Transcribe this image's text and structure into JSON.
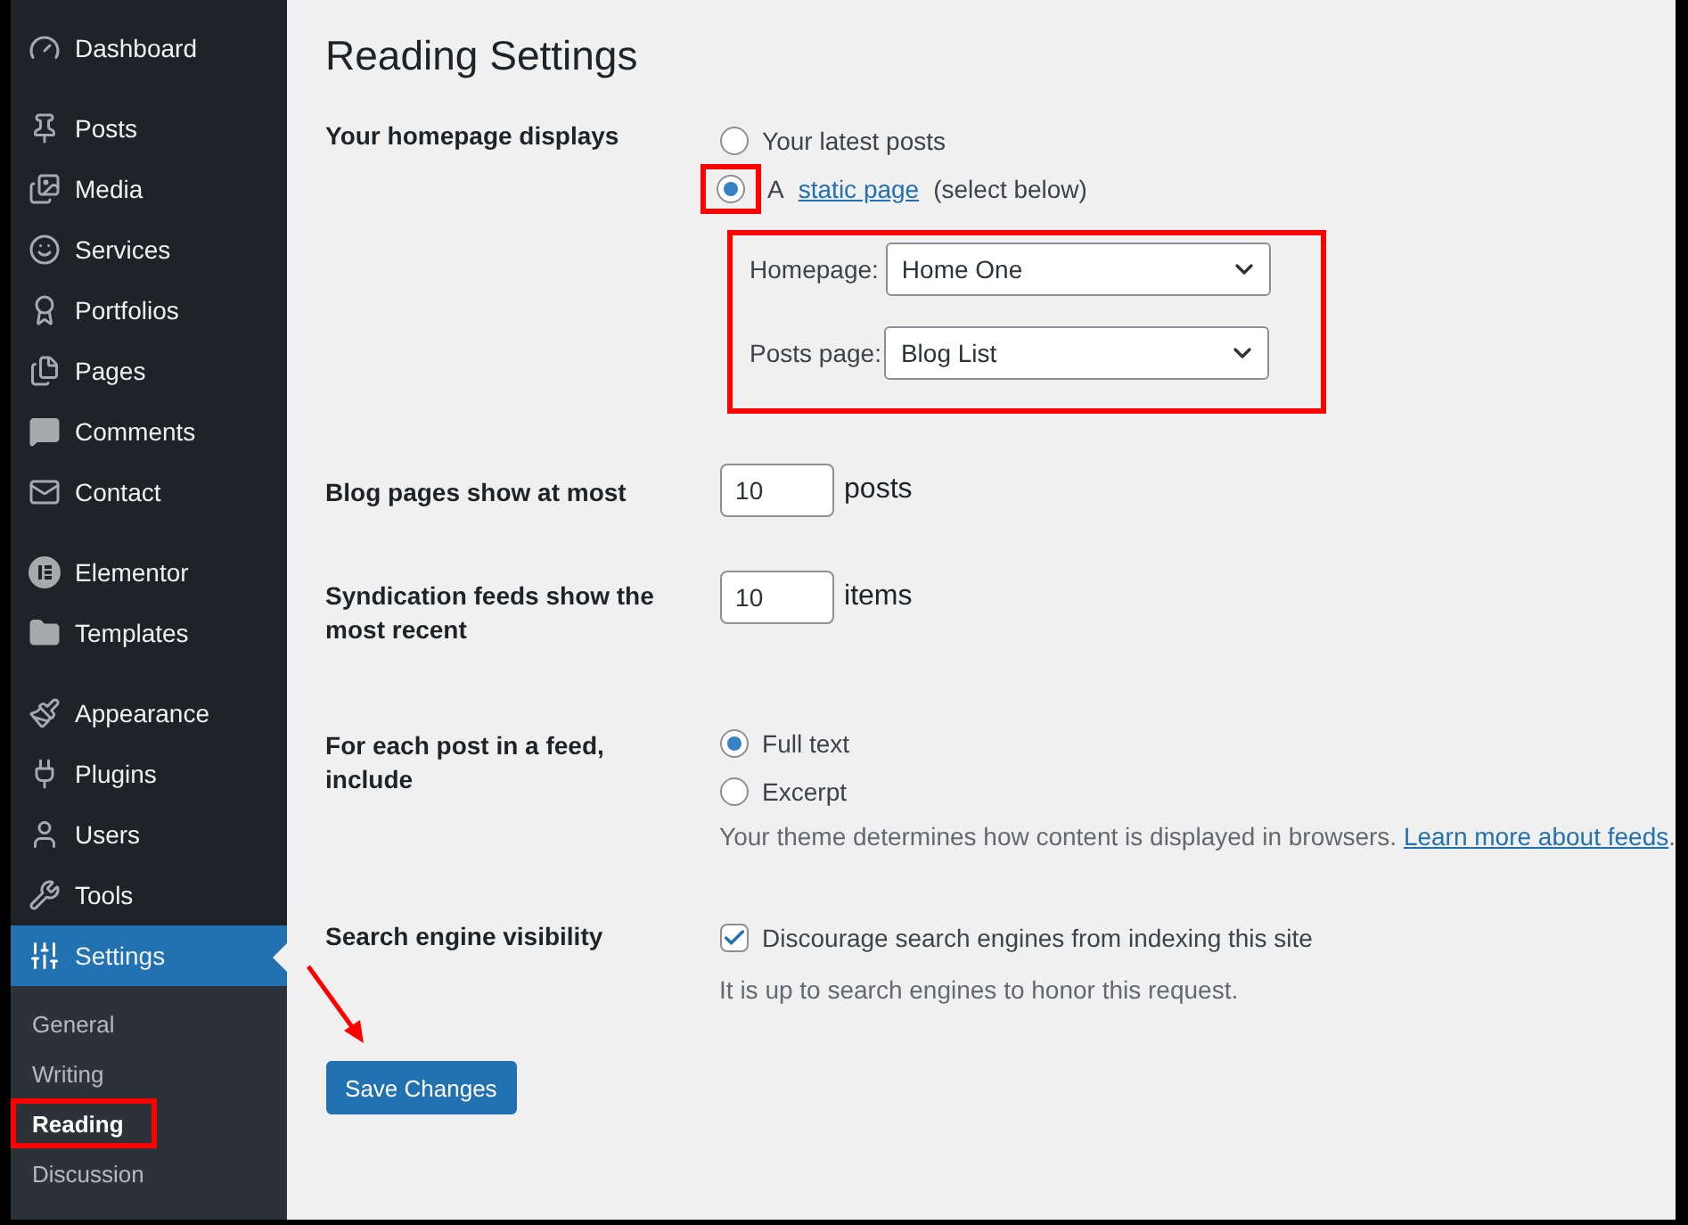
{
  "sidebar": {
    "groups": [
      [
        {
          "label": "Dashboard",
          "selected": false
        }
      ],
      [
        {
          "label": "Posts",
          "selected": false
        },
        {
          "label": "Media",
          "selected": false
        },
        {
          "label": "Services",
          "selected": false
        },
        {
          "label": "Portfolios",
          "selected": false
        },
        {
          "label": "Pages",
          "selected": false
        },
        {
          "label": "Comments",
          "selected": false
        },
        {
          "label": "Contact",
          "selected": false
        }
      ],
      [
        {
          "label": "Elementor",
          "selected": false
        },
        {
          "label": "Templates",
          "selected": false
        }
      ],
      [
        {
          "label": "Appearance",
          "selected": false
        },
        {
          "label": "Plugins",
          "selected": false
        },
        {
          "label": "Users",
          "selected": false
        },
        {
          "label": "Tools",
          "selected": false
        },
        {
          "label": "Settings",
          "selected": true
        }
      ]
    ],
    "submenu": [
      {
        "label": "General",
        "selected": false,
        "annotated": false
      },
      {
        "label": "Writing",
        "selected": false,
        "annotated": false
      },
      {
        "label": "Reading",
        "selected": true,
        "annotated": true
      },
      {
        "label": "Discussion",
        "selected": false,
        "annotated": false
      }
    ]
  },
  "page": {
    "title": "Reading Settings",
    "homepage_displays": {
      "label": "Your homepage displays",
      "options": [
        {
          "kind": "plain",
          "text": "Your latest posts",
          "selected": false,
          "annotated": false
        },
        {
          "kind": "link",
          "before": "A",
          "link": "static page",
          "after": "(select below)",
          "selected": true,
          "annotated": true
        }
      ],
      "selects_annotated": true,
      "selects": [
        {
          "label": "Homepage:",
          "value": "Home One"
        },
        {
          "label": "Posts page:",
          "value": "Blog List"
        }
      ]
    },
    "blog_pages": {
      "label": "Blog pages show at most",
      "value": "10",
      "unit": "posts"
    },
    "syndication": {
      "label": "Syndication feeds show the most recent",
      "value": "10",
      "unit": "items"
    },
    "feed_include": {
      "label": "For each post in a feed, include",
      "options": [
        {
          "text": "Full text",
          "selected": true
        },
        {
          "text": "Excerpt",
          "selected": false
        }
      ],
      "description": "Your theme determines how content is displayed in browsers.",
      "link": "Learn more about feeds",
      "after": "."
    },
    "search_visibility": {
      "label": "Search engine visibility",
      "checkbox": {
        "text": "Discourage search engines from indexing this site",
        "checked": true
      },
      "description": "It is up to search engines to honor this request."
    },
    "save_button": "Save Changes"
  }
}
